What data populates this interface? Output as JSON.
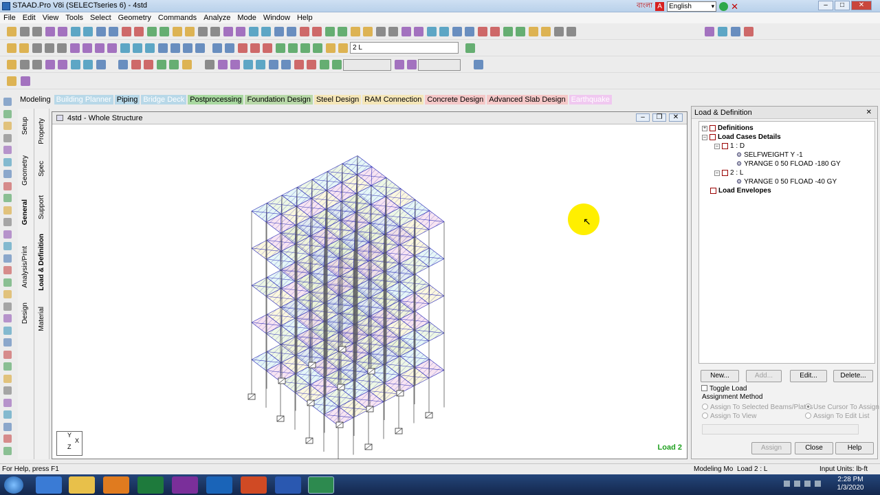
{
  "titlebar": {
    "title": "STAAD.Pro V8i (SELECTseries 6) - 4std",
    "language_script": "বাংলা",
    "language_value": "English"
  },
  "menu": [
    "File",
    "Edit",
    "View",
    "Tools",
    "Select",
    "Geometry",
    "Commands",
    "Analyze",
    "Mode",
    "Window",
    "Help"
  ],
  "toolbar": {
    "load_select": "2 L"
  },
  "page_tabs": [
    {
      "label": "Modeling",
      "bg": "#ececec",
      "color": "#000000"
    },
    {
      "label": "Building Planner",
      "bg": "#b8d8e8",
      "color": "#ffffff"
    },
    {
      "label": "Piping",
      "bg": "#b8d8e8",
      "color": "#000000"
    },
    {
      "label": "Bridge Deck",
      "bg": "#b8d8e8",
      "color": "#ffffff"
    },
    {
      "label": "Postprocessing",
      "bg": "#a8d8a0",
      "color": "#000000"
    },
    {
      "label": "Foundation Design",
      "bg": "#b8d8a8",
      "color": "#000000"
    },
    {
      "label": "Steel Design",
      "bg": "#f5e6b8",
      "color": "#000000"
    },
    {
      "label": "RAM Connection",
      "bg": "#f5e6b8",
      "color": "#000000"
    },
    {
      "label": "Concrete Design",
      "bg": "#f5c8c8",
      "color": "#000000"
    },
    {
      "label": "Advanced Slab Design",
      "bg": "#f5c8c8",
      "color": "#000000"
    },
    {
      "label": "Earthquake",
      "bg": "#f0c8f0",
      "color": "#ffffff"
    }
  ],
  "side_tabs": {
    "outer": [
      "Setup",
      "Geometry",
      "General",
      "Analysis/Print",
      "Design"
    ],
    "inner": [
      "Property",
      "Spec",
      "Support",
      "Load & Definition",
      "Material"
    ]
  },
  "viewport": {
    "title": "4std  - Whole Structure",
    "load_label": "Load 2",
    "axis_y": "Y",
    "axis_z": "Z",
    "axis_x": "X"
  },
  "panel": {
    "title": "Load & Definition",
    "tree": {
      "definitions": "Definitions",
      "load_cases": "Load Cases Details",
      "case1": "1 : D",
      "case1_item1": "SELFWEIGHT Y -1",
      "case1_item2": "YRANGE 0 50 FLOAD -180 GY",
      "case2": "2 : L",
      "case2_item1": "YRANGE 0 50 FLOAD -40 GY",
      "envelopes": "Load Envelopes"
    },
    "buttons": {
      "new": "New...",
      "add": "Add...",
      "edit": "Edit...",
      "delete": "Delete...",
      "assign": "Assign",
      "close": "Close",
      "help": "Help"
    },
    "toggle_load": "Toggle Load",
    "assignment_method": "Assignment Method",
    "opt_selected": "Assign To Selected Beams/Plates",
    "opt_cursor": "Use Cursor To Assign",
    "opt_view": "Assign To View",
    "opt_edit_list": "Assign To Edit List"
  },
  "status": {
    "help": "For Help, press F1",
    "mode": "Modeling Mo",
    "load": "Load 2 : L",
    "units": "Input Units:   lb-ft"
  },
  "taskbar": {
    "time": "2:28 PM",
    "date": "1/3/2020"
  }
}
